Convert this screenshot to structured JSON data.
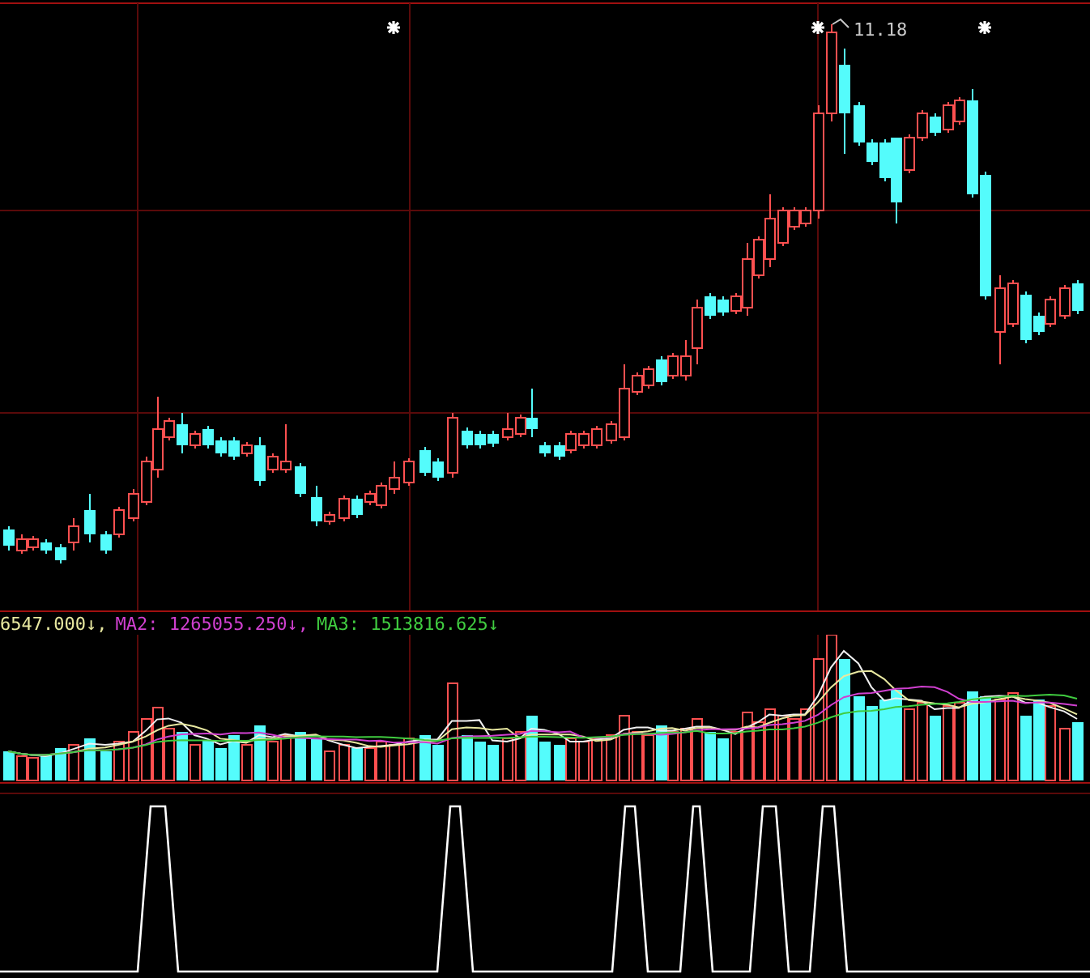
{
  "price_chart": {
    "high_label": "11.18"
  },
  "volume_legend": [
    {
      "text": "6547.000↓,",
      "color": "#e8e8a0"
    },
    {
      "text": "MA2: 1265055.250↓,",
      "color": "#d040d0"
    },
    {
      "text": "MA3: 1513816.625↓",
      "color": "#40cc40"
    }
  ]
}
